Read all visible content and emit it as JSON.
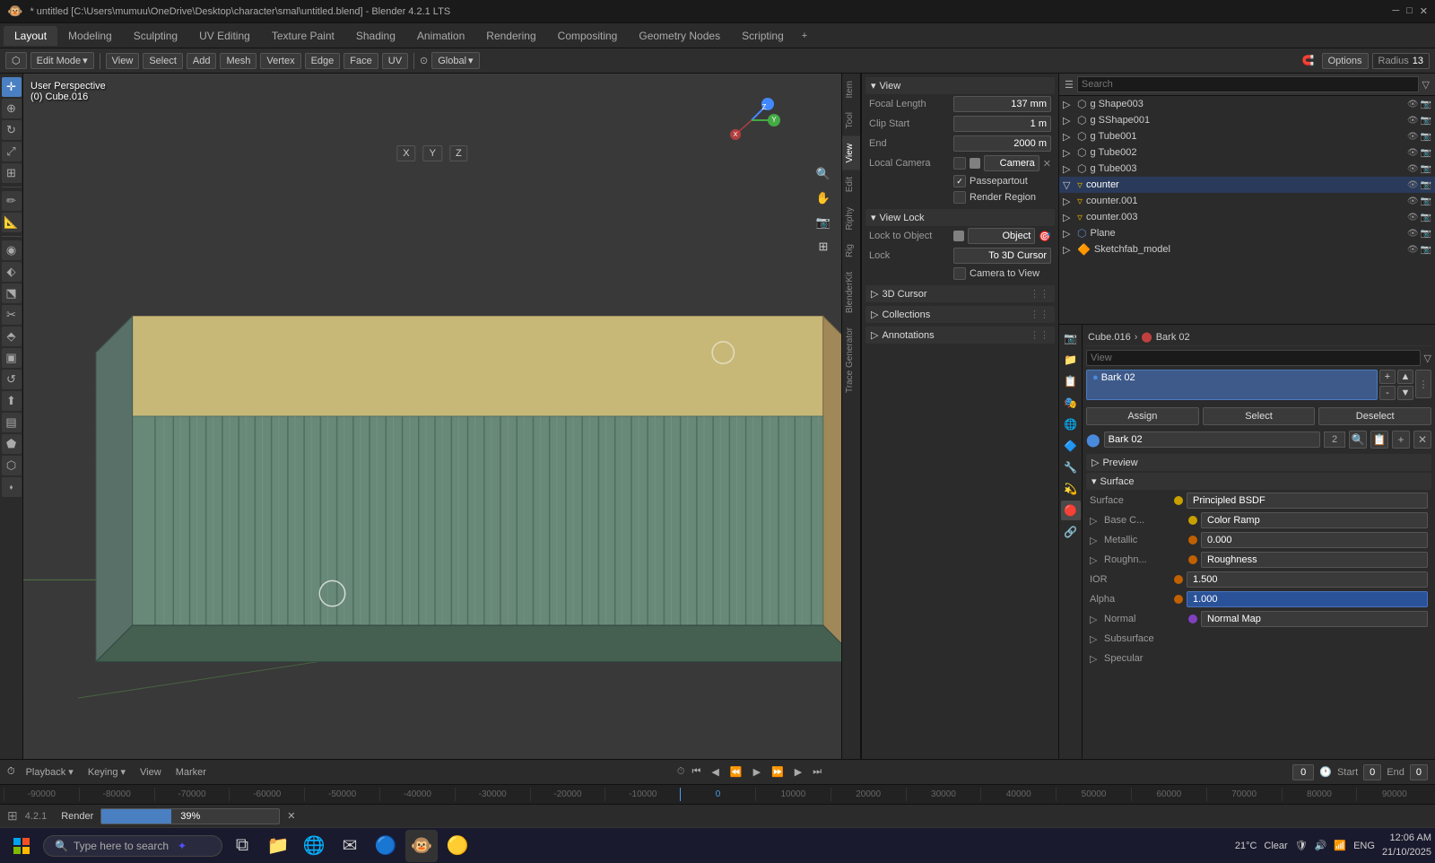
{
  "window": {
    "title": "* untitled [C:\\Users\\mumuu\\OneDrive\\Desktop\\character\\smal\\untitled.blend] - Blender 4.2.1 LTS"
  },
  "workspace_tabs": [
    "Layout",
    "Modeling",
    "Sculpting",
    "UV Editing",
    "Texture Paint",
    "Shading",
    "Animation",
    "Rendering",
    "Compositing",
    "Geometry Nodes",
    "Scripting"
  ],
  "active_workspace": "Layout",
  "toolbar": {
    "mode": "Edit Mode",
    "view": "View",
    "select": "Select",
    "add": "Add",
    "mesh": "Mesh",
    "vertex": "Vertex",
    "edge": "Edge",
    "face": "Face",
    "uv": "UV",
    "transform": "Global",
    "options": "Options",
    "radius_label": "Radius",
    "radius_value": "13"
  },
  "viewport": {
    "mode": "User Perspective",
    "object": "(0) Cube.016"
  },
  "n_panel": {
    "view_section": "View",
    "focal_length_label": "Focal Length",
    "focal_length_value": "137 mm",
    "clip_start_label": "Clip Start",
    "clip_start_value": "1 m",
    "end_label": "End",
    "end_value": "2000 m",
    "local_camera_label": "Local Camera",
    "local_camera_value": "Camera",
    "passepartout_label": "Passepartout",
    "render_region_label": "Render Region",
    "view_lock_section": "View Lock",
    "lock_to_object_label": "Lock to Object",
    "lock_to_object_value": "Object",
    "lock_label": "Lock",
    "lock_to_3d_cursor": "To 3D Cursor",
    "camera_to_view": "Camera to View",
    "cursor_section": "3D Cursor",
    "collections_section": "Collections",
    "annotations_section": "Annotations"
  },
  "outliner": {
    "search_placeholder": "Search",
    "items": [
      {
        "name": "g Shape003",
        "icon": "▷",
        "indent": 1,
        "type": "mesh"
      },
      {
        "name": "g SShape001",
        "icon": "▷",
        "indent": 1,
        "type": "mesh"
      },
      {
        "name": "g Tube001",
        "icon": "▷",
        "indent": 1,
        "type": "mesh"
      },
      {
        "name": "g Tube002",
        "icon": "▷",
        "indent": 1,
        "type": "mesh"
      },
      {
        "name": "g Tube003",
        "icon": "▷",
        "indent": 1,
        "type": "mesh"
      },
      {
        "name": "counter",
        "icon": "▽",
        "indent": 1,
        "type": "mesh",
        "active": true
      },
      {
        "name": "counter.001",
        "icon": "▷",
        "indent": 1,
        "type": "mesh"
      },
      {
        "name": "counter.003",
        "icon": "▷",
        "indent": 1,
        "type": "mesh"
      },
      {
        "name": "Plane",
        "icon": "▷",
        "indent": 1,
        "type": "plane"
      },
      {
        "name": "Sketchfab_model",
        "icon": "▷",
        "indent": 1,
        "type": "model"
      }
    ]
  },
  "properties": {
    "breadcrumb_object": "Cube.016",
    "breadcrumb_material": "Bark 02",
    "active_material": "Bark 02",
    "material_slots": [
      {
        "name": "Bark 02",
        "active": true
      }
    ],
    "assign_btn": "Assign",
    "select_btn": "Select",
    "deselect_btn": "Deselect",
    "mat_name": "Bark 02",
    "mat_user_count": "2",
    "preview_section": "Preview",
    "surface_section": "Surface",
    "surface_label": "Surface",
    "surface_value": "Principled BSDF",
    "base_color_label": "Base C...",
    "base_color_value": "Color Ramp",
    "metallic_label": "Metallic",
    "metallic_value": "0.000",
    "roughness_label": "Roughn...",
    "roughness_value": "Roughness",
    "ior_label": "IOR",
    "ior_value": "1.500",
    "alpha_label": "Alpha",
    "alpha_value": "1.000",
    "normal_label": "Normal",
    "normal_value": "Normal Map",
    "subsurface_label": "Subsurface",
    "specular_label": "Specular"
  },
  "timeline": {
    "playback": "Playback",
    "keying": "Keying",
    "view": "View",
    "marker": "Marker",
    "start": "0",
    "start_label": "Start",
    "current_frame": "0",
    "end_label": "End",
    "end": "0"
  },
  "render_status": {
    "label": "Render",
    "progress": "39%",
    "progress_value": 39
  },
  "taskbar": {
    "search_placeholder": "Type here to search",
    "temperature": "21°C",
    "weather": "Clear",
    "language": "ENG",
    "time": "12:06 AM",
    "date": "21/10/2025",
    "version": "4.2.1"
  },
  "frame_numbers": [
    "-90000",
    "-80000",
    "-70000",
    "-60000",
    "-50000",
    "-40000",
    "-30000",
    "-20000",
    "-10000",
    "0",
    "10000",
    "20000",
    "30000",
    "40000",
    "50000",
    "60000",
    "70000",
    "80000",
    "90000"
  ],
  "sidebar_tabs": [
    "Item",
    "Tool",
    "View",
    "Edit",
    "Riphy",
    "Rig",
    "BlenderKit",
    "Trace Generator"
  ],
  "icons": {
    "search": "🔍",
    "gear": "⚙",
    "camera": "📷",
    "mesh": "⬡",
    "cursor": "✛",
    "move": "⊕",
    "rotate": "↻",
    "scale": "⤢",
    "transform": "⊞",
    "annotate": "✏",
    "measure": "📏",
    "add_object": "➕",
    "material": "🔴",
    "render": "🎬",
    "output": "📁",
    "view_layer": "📋",
    "scene": "🎭",
    "world": "🌐",
    "object": "🔷",
    "modifier": "🔧",
    "particles": "💫",
    "physics": "⚡",
    "constraint": "🔗",
    "object_data": "▿"
  }
}
